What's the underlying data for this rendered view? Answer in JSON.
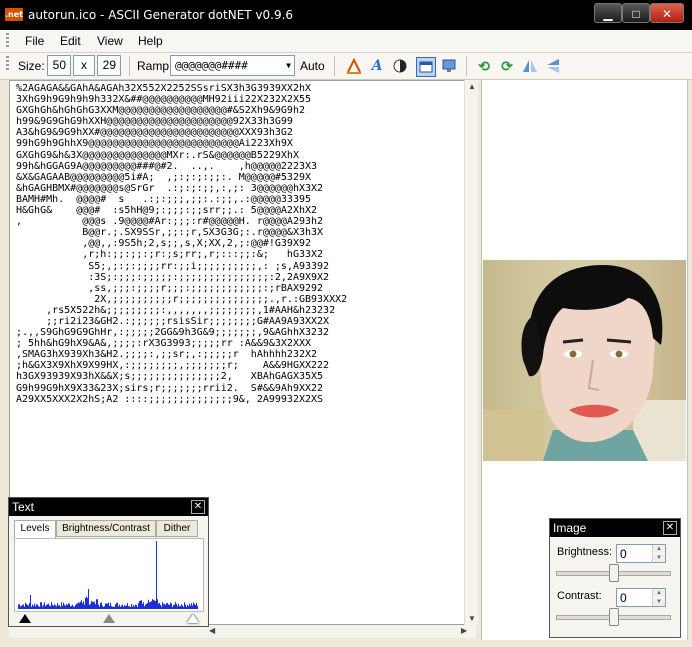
{
  "window": {
    "title": "autorun.ico - ASCII Generator dotNET v0.9.6",
    "icon_label": ".net",
    "buttons": {
      "minimize": "▁",
      "maximize": "□",
      "close": "✕"
    }
  },
  "menu": [
    "File",
    "Edit",
    "View",
    "Help"
  ],
  "toolbar": {
    "size_label": "Size:",
    "width": "50",
    "times": "x",
    "height": "29",
    "ramp_label": "Ramp:",
    "ramp_value": "@@@@@@@####",
    "auto_label": "Auto",
    "icons": [
      "font-color-icon",
      "font-icon",
      "invert-icon",
      "fit-icon",
      "monitor-icon",
      "rotate-left-icon",
      "rotate-right-icon",
      "flip-horizontal-icon",
      "flip-vertical-icon"
    ]
  },
  "ascii_art": [
    "%2AGAGA&&GAhA&AGAh32X552X2252SSsriSX3h3G3939XX2hX",
    "3XhG9h9G9h9h9h332X&##@@@@@@@@@@MH92iii22X232X2X55",
    "GXGhGh&hGhGhG3XXM@@@@@@@@@@@@@@@@@@#&S2Xh9&9G9h2",
    "h99&9G9GhG9hXXH@@@@@@@@@@@@@@@@@@@@@92X33h3G99",
    "A3&hG9&9G9hXX#@@@@@@@@@@@@@@@@@@@@@@@XXX93h3G2",
    "99hG9h9GhhX9@@@@@@@@@@@@@@@@@@@@@@@@@Ai223Xh9X",
    "GXGhG9&h&3X@@@@@@@@@@@@@@MXr:.rS&@@@@@@B5229XhX",
    "99h&hGGAG9A@@@@@@@@@###@#2.  ..,.    ,h@@@@@2223X3",
    "&X&GAGAAB@@@@@@@@@5i#A;  ,;:;:;:;;:. M@@@@@#5329X",
    "&hGAGHBMX#@@@@@@@s@SrGr  .:;:;:;;,:,;: 3@@@@@@hX3X2",
    "BAMH#Mh.  @@@@#  s   .:;:;;;,;;:.:;;,.:@@@@@33395",
    "H&GhG&    @@@#  :s5hH@9;:;;;:;;srr;;.: 5@@@@A2XhX2",
    ",          @@@s .9@@@@#Ar:;;;:r#@@@@@H. r@@@@A293h2",
    "           B@@r.;.SX9SSr,;;:;r,SX3G3G;:.r@@@@&X3h3X",
    "           ,@@,,:9S5h;2,s;;,s,X;XX,2,;:@@#!G39X92",
    "           ,r;h:;;:;;:;r:;s;rr;,r;:::;;:&;   hG33X2",
    "            S5;,;:;:;;;;rr:;;i;;;;;;;;;;,: ;s,A93392",
    "            :3S;:;;;:;;;;;:;;;;;;;;;;;;;;;:2,2A9X9X2",
    "            ,ss,;;;:;;;;r;;;:;;;;;;;;;;;;:;rBAX9292",
    "             2X,;;;;;;;;;;r;;;;;;;;;;;;;;;.,r.:GB93XXX2",
    "     ,rs5X522h&;;;;;;;;;:,,,,,,,;;;;;;;;,1#AAH&h23232",
    "     ;;ri2i23&GH2.:;;;;;;rsisSir;;;;;;;;G#AA9A93XX2X",
    ";.,,S9GhG9G9GhHr,:;;;;;2GG&9h3G&9;;;;;;;,9&AGhhX3232",
    "; 5hh&hG9hX9&A&,;;;;:rX3G3993;;;;;rr :A&&9&3X2XXX",
    ",SMAG3hX939Xh3&H2.;;;;:,;;sr;,:;;;;;r  hAhhhh232X2",
    ";h&GX3X9XhX9X99HX,:;;;;;;;;,;;;;;;;r;    A&&9HGXX222",
    "h3GX93939X93hX&&X;s;;;;;;;;;;;;;;;2,   XBAhGAGX35X5",
    "G9h99G9hX9X33&23X;sirs;r;;;;;;;rrii2.  S#&&9Ah9XX22",
    "A29XX5XXX2X2hS;A2 ::::;;;;;;;;;;;;;;9&, 2A99932X2XS"
  ],
  "text_panel": {
    "title": "Text",
    "tabs": [
      "Levels",
      "Brightness/Contrast",
      "Dither"
    ]
  },
  "image_panel": {
    "title": "Image",
    "brightness_label": "Brightness:",
    "brightness_value": "0",
    "brightness_level": 0.5,
    "contrast_label": "Contrast:",
    "contrast_value": "0",
    "contrast_level": 0.5
  },
  "levels": {
    "min": 0,
    "mid": 0.5,
    "max": 1
  }
}
